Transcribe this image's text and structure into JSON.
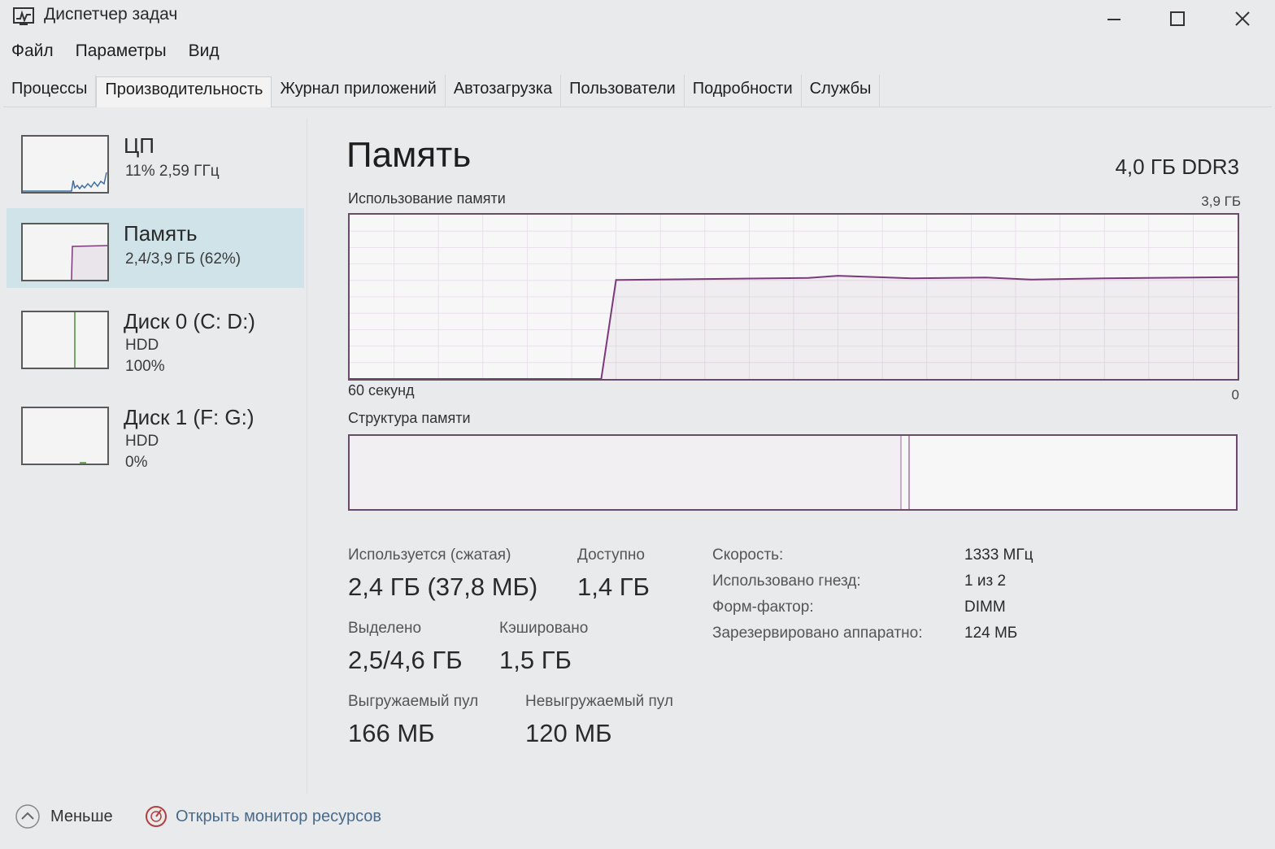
{
  "window": {
    "title": "Диспетчер задач"
  },
  "menu": [
    "Файл",
    "Параметры",
    "Вид"
  ],
  "tabs": [
    "Процессы",
    "Производительность",
    "Журнал приложений",
    "Автозагрузка",
    "Пользователи",
    "Подробности",
    "Службы"
  ],
  "active_tab": "Производительность",
  "sidebar": {
    "items": [
      {
        "title": "ЦП",
        "lines": [
          "11% 2,59 ГГц"
        ]
      },
      {
        "title": "Память",
        "lines": [
          "2,4/3,9 ГБ (62%)"
        ],
        "selected": true
      },
      {
        "title": "Диск 0 (C: D:)",
        "lines": [
          "HDD",
          "100%"
        ]
      },
      {
        "title": "Диск 1 (F: G:)",
        "lines": [
          "HDD",
          "0%"
        ]
      }
    ]
  },
  "main": {
    "title": "Память",
    "spec": "4,0 ГБ DDR3",
    "usage_chart": {
      "label": "Использование памяти",
      "max_label": "3,9 ГБ",
      "x_left_label": "60 секунд",
      "x_right_label": "0"
    },
    "structure_label": "Структура памяти",
    "stats": {
      "in_use_label": "Используется (сжатая)",
      "in_use_value": "2,4 ГБ (37,8 МБ)",
      "available_label": "Доступно",
      "available_value": "1,4 ГБ",
      "committed_label": "Выделено",
      "committed_value": "2,5/4,6 ГБ",
      "cached_label": "Кэшировано",
      "cached_value": "1,5 ГБ",
      "paged_label": "Выгружаемый пул",
      "paged_value": "166 МБ",
      "nonpaged_label": "Невыгружаемый пул",
      "nonpaged_value": "120 МБ"
    },
    "specs": [
      {
        "label": "Скорость:",
        "value": "1333 МГц"
      },
      {
        "label": "Использовано гнезд:",
        "value": "1 из 2"
      },
      {
        "label": "Форм-фактор:",
        "value": "DIMM"
      },
      {
        "label": "Зарезервировано аппаратно:",
        "value": "124 МБ"
      }
    ]
  },
  "footer": {
    "fewer_label": "Меньше",
    "monitor_label": "Открыть монитор ресурсов"
  },
  "chart_data": {
    "type": "line",
    "title": "Использование памяти",
    "xlabel": "",
    "ylabel": "",
    "x_range_label": [
      "60 секунд",
      "0"
    ],
    "ylim": [
      0,
      3.9
    ],
    "series": [
      {
        "x": [
          60,
          57,
          43,
          42,
          29,
          27,
          22,
          17,
          14,
          9,
          0
        ],
        "values": [
          0,
          0,
          0,
          2.35,
          2.4,
          2.45,
          2.39,
          2.41,
          2.36,
          2.39,
          2.42
        ]
      }
    ]
  }
}
